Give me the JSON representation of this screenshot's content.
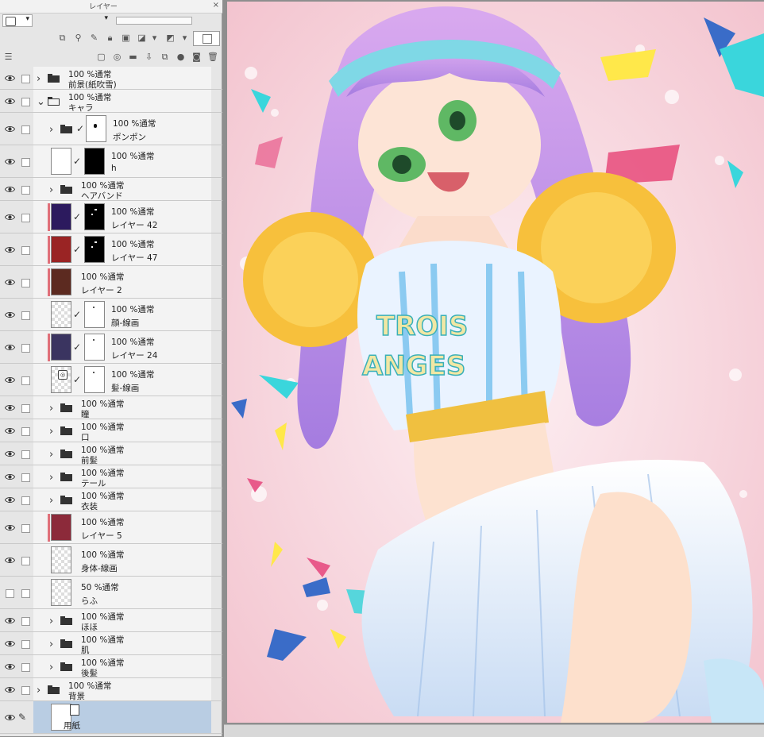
{
  "panel": {
    "title": "レイヤー",
    "close_glyph": "×",
    "blend_mode": "",
    "opacity_value": ""
  },
  "layers": [
    {
      "type": "folder",
      "mode": "100 %通常",
      "name": "前景(紙吹雪)",
      "visible": true,
      "open": false,
      "depth": 0
    },
    {
      "type": "folder",
      "mode": "100 %通常",
      "name": "キャラ",
      "visible": true,
      "open": true,
      "depth": 0
    },
    {
      "type": "folder",
      "mode": "100 %通常",
      "name": "ポンポン",
      "visible": true,
      "open": false,
      "depth": 1,
      "mask": true
    },
    {
      "type": "layer",
      "mode": "100 %通常",
      "name": "h",
      "visible": true,
      "color": "#ffffff",
      "mask": true
    },
    {
      "type": "folder",
      "mode": "100 %通常",
      "name": "ヘアバンド",
      "visible": true,
      "open": false,
      "depth": 1
    },
    {
      "type": "layer",
      "mode": "100 %通常",
      "name": "レイヤー 42",
      "visible": true,
      "color": "#2c1a5e",
      "mask": true,
      "clip": true
    },
    {
      "type": "layer",
      "mode": "100 %通常",
      "name": "レイヤー 47",
      "visible": true,
      "color": "#9a2424",
      "mask": true,
      "clip": true
    },
    {
      "type": "layer",
      "mode": "100 %通常",
      "name": "レイヤー 2",
      "visible": true,
      "color": "#5c2a20",
      "clip": true
    },
    {
      "type": "layer",
      "mode": "100 %通常",
      "name": "顔-線画",
      "visible": true,
      "color": "checker",
      "mask": true
    },
    {
      "type": "layer",
      "mode": "100 %通常",
      "name": "レイヤー 24",
      "visible": true,
      "color": "#3a3460",
      "mask": true,
      "clip": true
    },
    {
      "type": "layer",
      "mode": "100 %通常",
      "name": "髪-線画",
      "visible": true,
      "color": "checker",
      "mask": true,
      "refer": true
    },
    {
      "type": "folder",
      "mode": "100 %通常",
      "name": "瞳",
      "visible": true,
      "open": false,
      "depth": 1
    },
    {
      "type": "folder",
      "mode": "100 %通常",
      "name": "口",
      "visible": true,
      "open": false,
      "depth": 1
    },
    {
      "type": "folder",
      "mode": "100 %通常",
      "name": "前髪",
      "visible": true,
      "open": false,
      "depth": 1
    },
    {
      "type": "folder",
      "mode": "100 %通常",
      "name": "テール",
      "visible": true,
      "open": false,
      "depth": 1
    },
    {
      "type": "folder",
      "mode": "100 %通常",
      "name": "衣装",
      "visible": true,
      "open": false,
      "depth": 1
    },
    {
      "type": "layer",
      "mode": "100 %通常",
      "name": "レイヤー 5",
      "visible": true,
      "color": "#8c2a3a",
      "clip": true
    },
    {
      "type": "layer",
      "mode": "100 %通常",
      "name": "身体-線画",
      "visible": true,
      "color": "checker"
    },
    {
      "type": "layer",
      "mode": "50 %通常",
      "name": "らふ",
      "visible": false,
      "color": "checker"
    },
    {
      "type": "folder",
      "mode": "100 %通常",
      "name": "ほほ",
      "visible": true,
      "open": false,
      "depth": 1
    },
    {
      "type": "folder",
      "mode": "100 %通常",
      "name": "肌",
      "visible": true,
      "open": false,
      "depth": 1
    },
    {
      "type": "folder",
      "mode": "100 %通常",
      "name": "後髪",
      "visible": true,
      "open": false,
      "depth": 1
    },
    {
      "type": "folder",
      "mode": "100 %通常",
      "name": "背景",
      "visible": true,
      "open": false,
      "depth": 0
    },
    {
      "type": "paper",
      "mode": "",
      "name": "用紙",
      "visible": true,
      "selected": true,
      "color": "#ffffff"
    }
  ],
  "canvas": {
    "artwork_text_line1": "TROIS",
    "artwork_text_line2": "ANGES"
  },
  "icons": [
    "eye-icon",
    "folder-icon",
    "chevron-right-icon",
    "chevron-down-icon",
    "pen-icon",
    "trash-icon",
    "new-layer-icon",
    "lock-icon",
    "mask-icon",
    "paper-icon"
  ]
}
